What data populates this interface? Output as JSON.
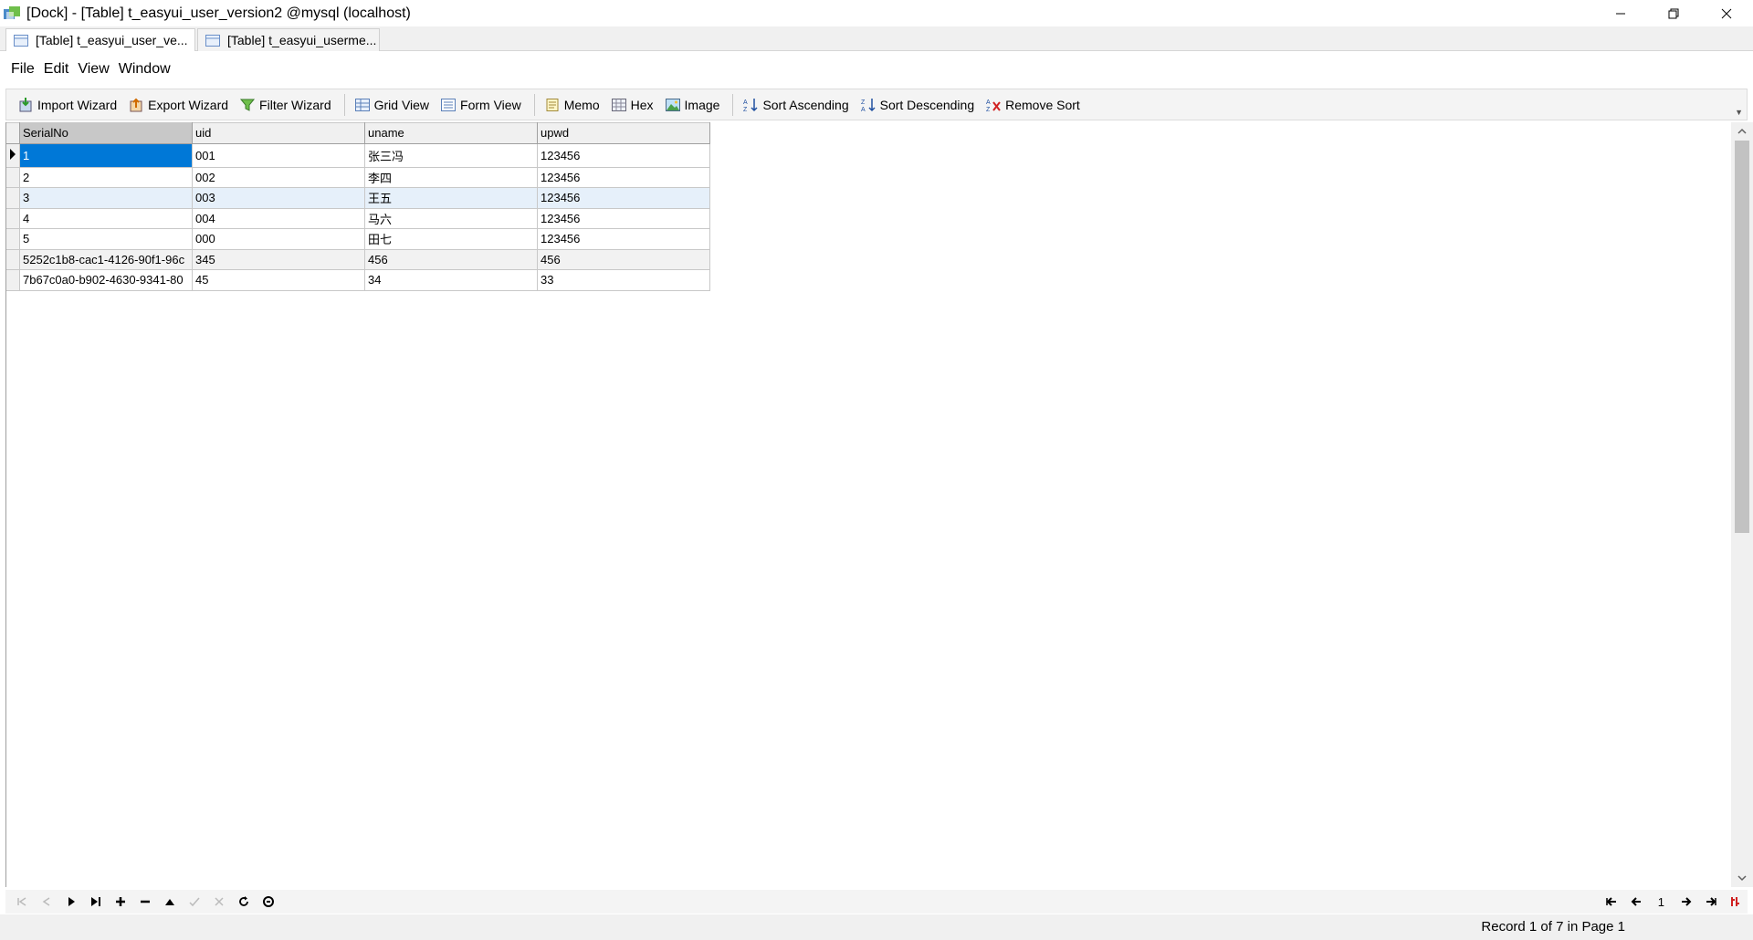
{
  "window": {
    "title": "[Dock] - [Table] t_easyui_user_version2 @mysql (localhost)"
  },
  "tabs": [
    {
      "label": "[Table] t_easyui_user_ve...",
      "active": true
    },
    {
      "label": "[Table] t_easyui_userme...",
      "active": false
    }
  ],
  "menu": {
    "file": "File",
    "edit": "Edit",
    "view": "View",
    "window": "Window"
  },
  "toolbar": {
    "import_wizard": "Import Wizard",
    "export_wizard": "Export Wizard",
    "filter_wizard": "Filter Wizard",
    "grid_view": "Grid View",
    "form_view": "Form View",
    "memo": "Memo",
    "hex": "Hex",
    "image": "Image",
    "sort_ascending": "Sort Ascending",
    "sort_descending": "Sort Descending",
    "remove_sort": "Remove Sort"
  },
  "grid": {
    "columns": [
      "SerialNo",
      "uid",
      "uname",
      "upwd"
    ],
    "rows": [
      [
        "1",
        "001",
        "张三冯",
        "123456"
      ],
      [
        "2",
        "002",
        "李四",
        "123456"
      ],
      [
        "3",
        "003",
        "王五",
        "123456"
      ],
      [
        "4",
        "004",
        "马六",
        "123456"
      ],
      [
        "5",
        "000",
        "田七",
        "123456"
      ],
      [
        "5252c1b8-cac1-4126-90f1-96c",
        "345",
        "456",
        "456"
      ],
      [
        "7b67c0a0-b902-4630-9341-80",
        "45",
        "34",
        "33"
      ]
    ]
  },
  "pager": {
    "page": "1"
  },
  "status": {
    "record": "Record 1 of 7 in Page 1"
  },
  "colors": {
    "selection": "#0078d7",
    "header": "#f0f0f0",
    "toolbar_bg": "#f4f4f4"
  }
}
